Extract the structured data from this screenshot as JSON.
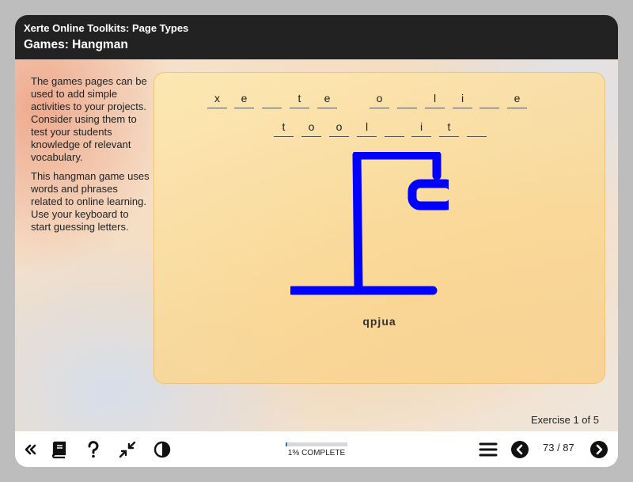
{
  "header": {
    "course_title": "Xerte Online Toolkits: Page Types",
    "page_title": "Games: Hangman"
  },
  "intro": {
    "paragraph1": "The games pages can be used to add simple activities to your projects. Consider using them to test your students knowledge of relevant vocabulary.",
    "paragraph2": "This hangman game uses words and phrases related to online learning. Use your keyboard to start guessing letters."
  },
  "game": {
    "word_row1": [
      "x",
      "e",
      "",
      "t",
      "e",
      " ",
      "o",
      "",
      "l",
      "i",
      "",
      "e"
    ],
    "word_row2": [
      "t",
      "o",
      "o",
      "l",
      "",
      "i",
      "t",
      ""
    ],
    "guessed_letters": "qpjua",
    "gallows_color": "#0000ff"
  },
  "exercise": {
    "label": "Exercise 1 of 5"
  },
  "footer": {
    "progress_percent": 1,
    "progress_label": "1% COMPLETE",
    "page_counter": "73 / 87",
    "buttons": [
      "first-page",
      "glossary",
      "help",
      "collapse",
      "contrast",
      "menu",
      "previous",
      "next"
    ]
  },
  "colors": {
    "header_bg": "#222222",
    "panel_border": "#f0c27a",
    "progress_fill": "#2f73c9"
  }
}
